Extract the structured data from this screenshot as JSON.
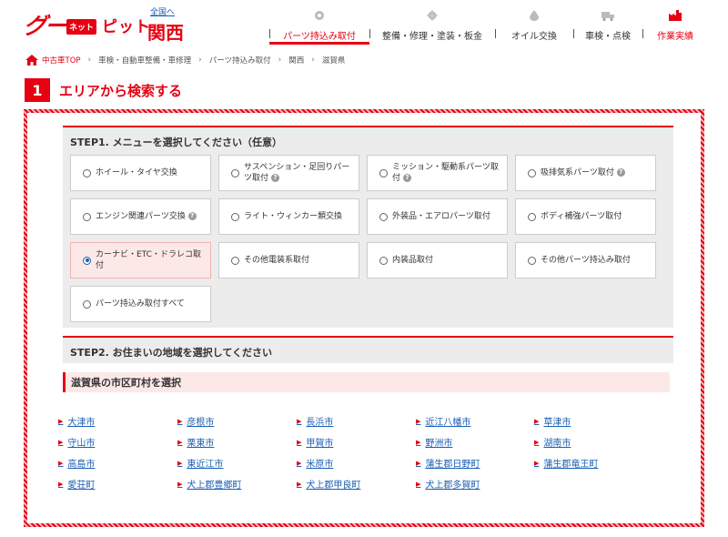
{
  "header": {
    "logo_goo": "グー",
    "logo_net": "ネット",
    "logo_pit": "ピット",
    "region_link": "全国へ",
    "region_name": "関西",
    "nav": [
      {
        "label": "パーツ持込み取付",
        "icon": "parts-icon",
        "active": true
      },
      {
        "label": "整備・修理・塗装・板金",
        "icon": "repair-gear-icon",
        "active": false
      },
      {
        "label": "オイル交換",
        "icon": "oil-drop-icon",
        "active": false
      },
      {
        "label": "車検・点検",
        "icon": "inspection-truck-icon",
        "active": false
      },
      {
        "label": "作業実績",
        "icon": "factory-icon",
        "active": false
      }
    ]
  },
  "breadcrumb": [
    "中古車TOP",
    "車検・自動車整備・車修理",
    "パーツ持込み取付",
    "関西",
    "滋賀県"
  ],
  "section": {
    "number": "1",
    "title": "エリアから検索する"
  },
  "step1": {
    "title": "STEP1. メニューを選択してください（任意）",
    "options": [
      {
        "label": "ホイール・タイヤ交換",
        "help": false,
        "selected": false
      },
      {
        "label": "サスペンション・足回りパーツ取付",
        "help": true,
        "selected": false
      },
      {
        "label": "ミッション・駆動系パーツ取付",
        "help": true,
        "selected": false
      },
      {
        "label": "吸排気系パーツ取付",
        "help": true,
        "selected": false
      },
      {
        "label": "エンジン関連パーツ交換",
        "help": true,
        "selected": false
      },
      {
        "label": "ライト・ウィンカー類交換",
        "help": false,
        "selected": false
      },
      {
        "label": "外装品・エアロパーツ取付",
        "help": false,
        "selected": false
      },
      {
        "label": "ボディ補強パーツ取付",
        "help": false,
        "selected": false
      },
      {
        "label": "カーナビ・ETC・ドラレコ取付",
        "help": false,
        "selected": true
      },
      {
        "label": "その他電装系取付",
        "help": false,
        "selected": false
      },
      {
        "label": "内装品取付",
        "help": false,
        "selected": false
      },
      {
        "label": "その他パーツ持込み取付",
        "help": false,
        "selected": false
      },
      {
        "label": "パーツ持込み取付すべて",
        "help": false,
        "selected": false
      }
    ]
  },
  "step2": {
    "title": "STEP2. お住まいの地域を選択してください"
  },
  "prefecture": {
    "title": "滋賀県の市区町村を選択"
  },
  "cities": [
    "大津市",
    "彦根市",
    "長浜市",
    "近江八幡市",
    "草津市",
    "守山市",
    "栗東市",
    "甲賀市",
    "野洲市",
    "湖南市",
    "高島市",
    "東近江市",
    "米原市",
    "蒲生郡日野町",
    "蒲生郡竜王町",
    "愛荘町",
    "犬上郡豊郷町",
    "犬上郡甲良町",
    "犬上郡多賀町"
  ],
  "colors": {
    "accent": "#e60012",
    "link": "#1a5fb4",
    "panel": "#ececec",
    "selected_bg": "#fde8e8"
  }
}
